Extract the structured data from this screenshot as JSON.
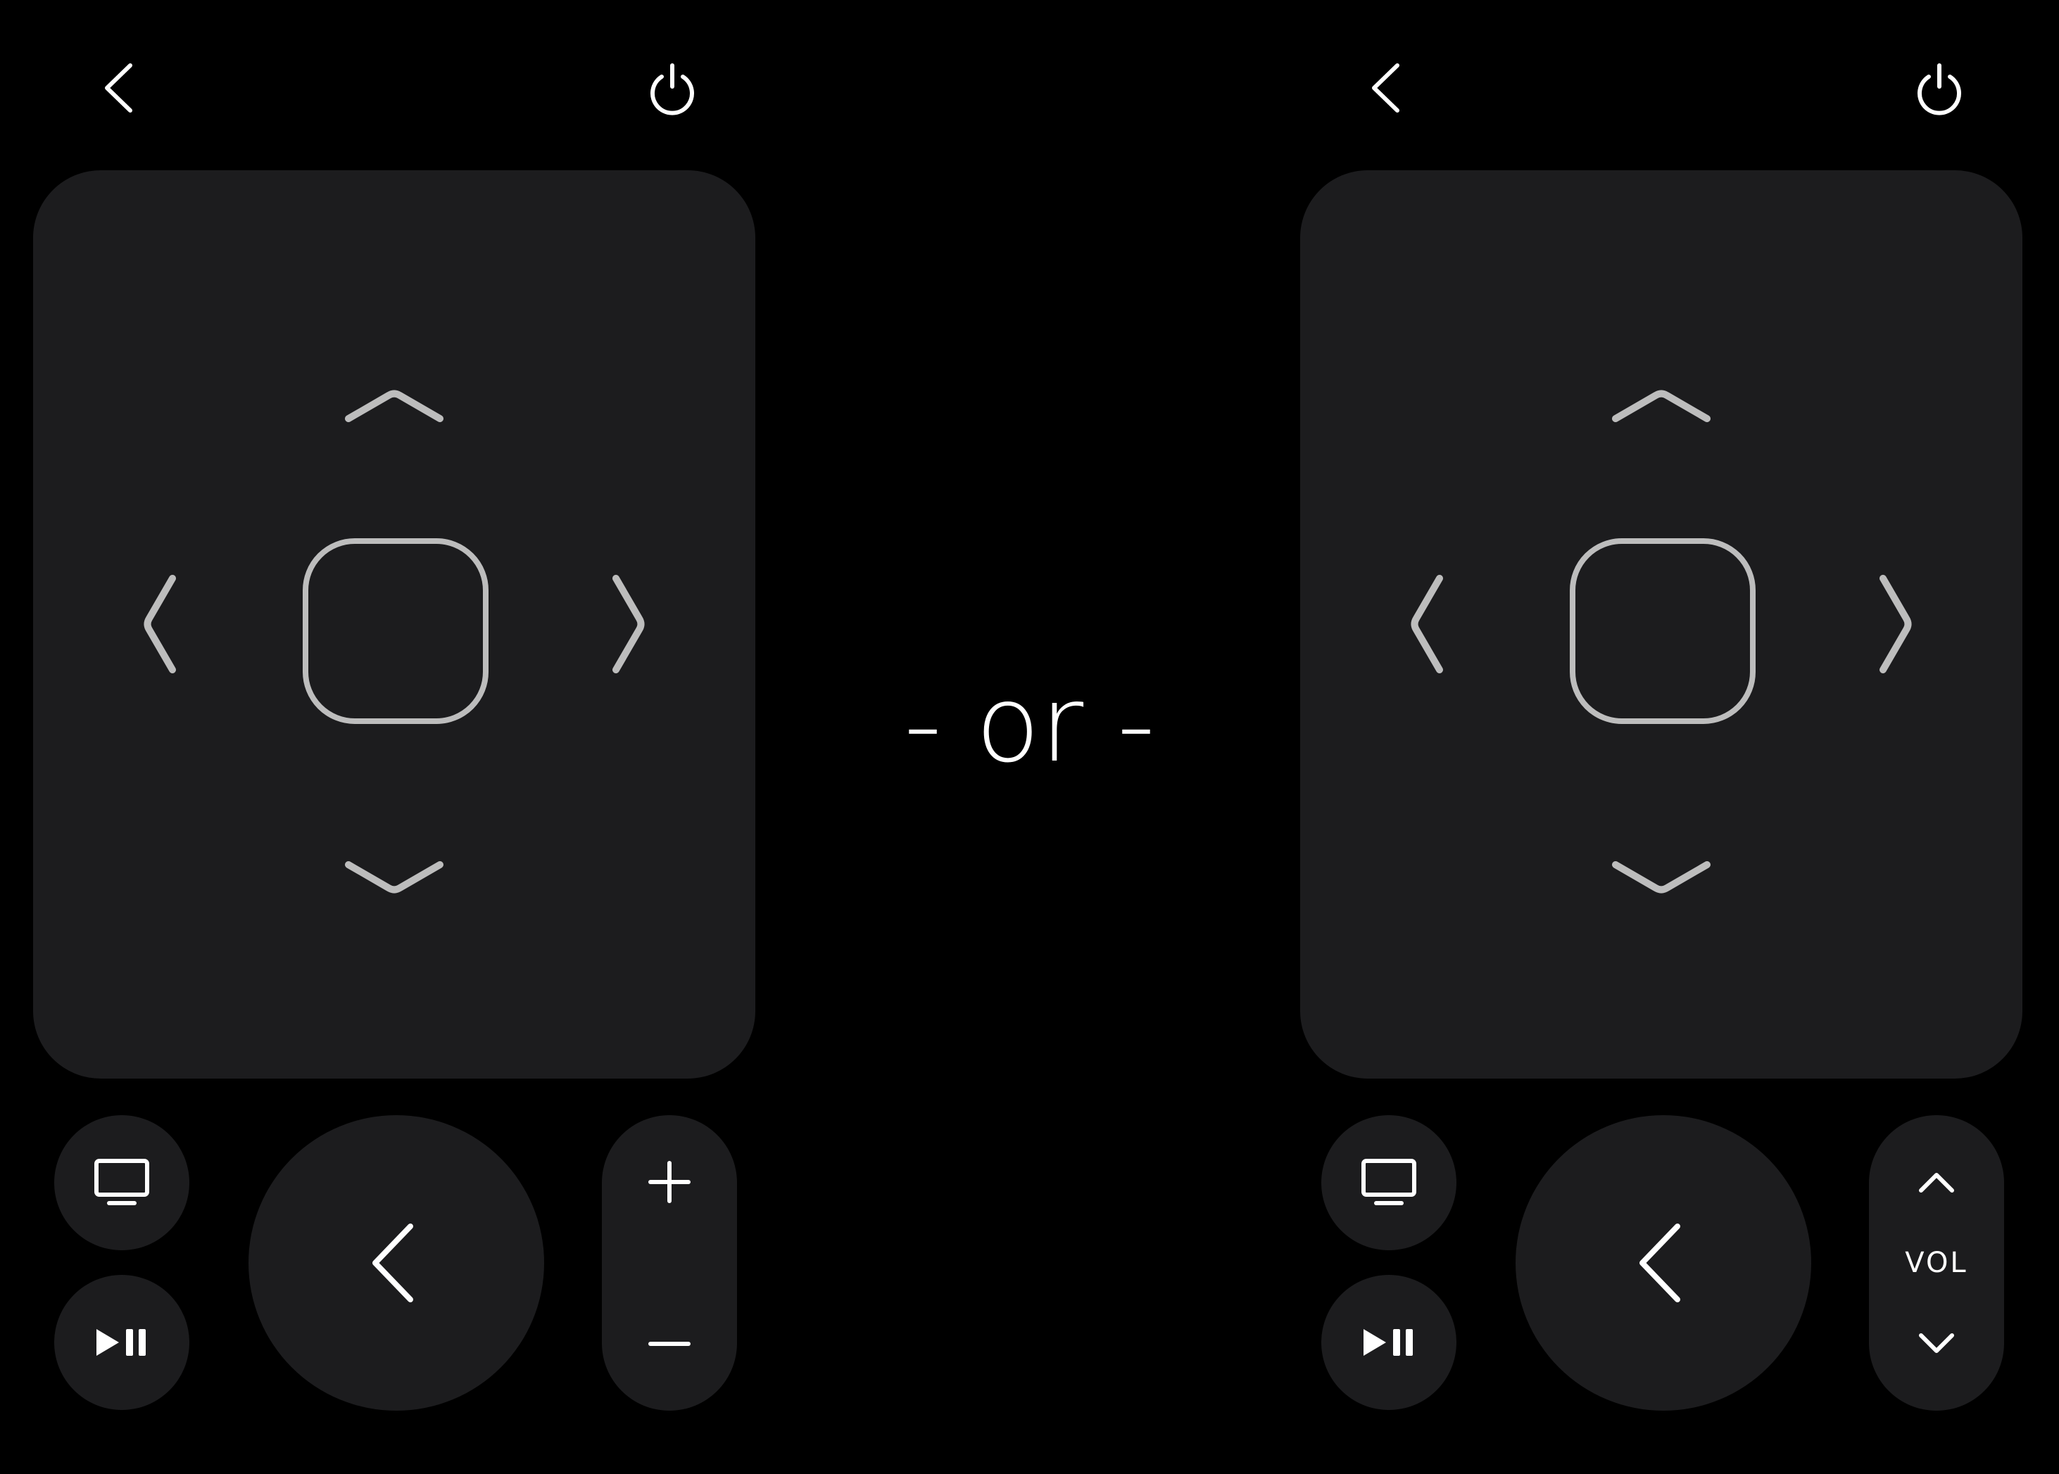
{
  "separator_text": "- or -",
  "colors": {
    "background": "#000000",
    "surface": "#1c1c1e",
    "icon_primary": "#ffffff",
    "icon_dpad": "#bdbdbd"
  },
  "remotes": [
    {
      "variant": "plus-minus-volume",
      "header": {
        "left_icon": "chevron-left-icon",
        "right_icon": "power-icon"
      },
      "touchpad": {
        "icons": [
          "chevron-up-icon",
          "chevron-down-icon",
          "chevron-left-icon",
          "chevron-right-icon",
          "rounded-square-icon"
        ]
      },
      "buttons": {
        "tv_icon": "tv-icon",
        "play_pause_icon": "play-pause-icon",
        "back_icon": "chevron-left-icon"
      },
      "volume": {
        "up_glyph": "+",
        "down_glyph": "−",
        "label": ""
      }
    },
    {
      "variant": "vol-label-volume",
      "header": {
        "left_icon": "chevron-left-icon",
        "right_icon": "power-icon"
      },
      "touchpad": {
        "icons": [
          "chevron-up-icon",
          "chevron-down-icon",
          "chevron-left-icon",
          "chevron-right-icon",
          "rounded-square-icon"
        ]
      },
      "buttons": {
        "tv_icon": "tv-icon",
        "play_pause_icon": "play-pause-icon",
        "back_icon": "chevron-left-icon"
      },
      "volume": {
        "up_glyph": "",
        "down_glyph": "",
        "label": "VOL"
      }
    }
  ]
}
